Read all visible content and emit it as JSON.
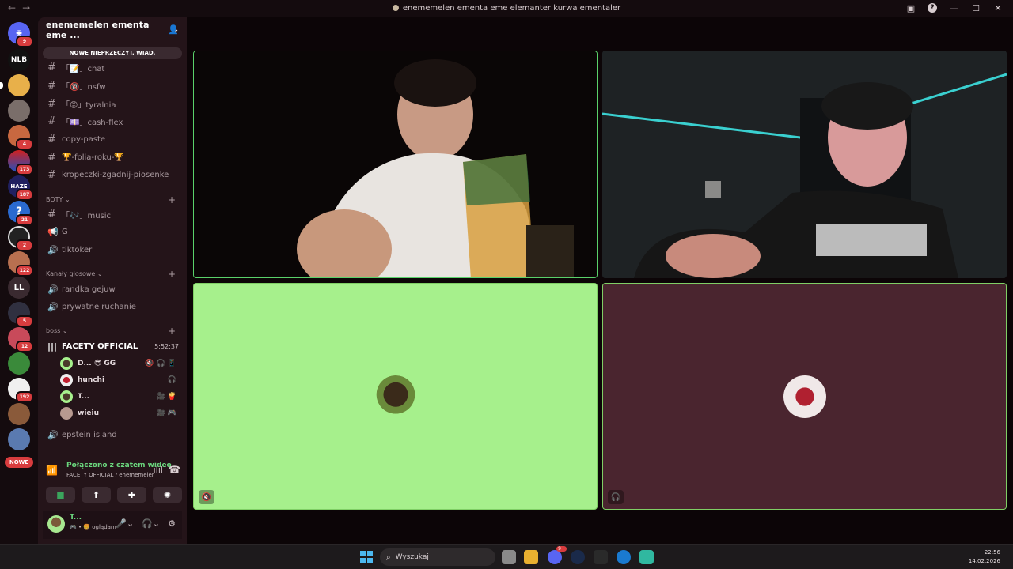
{
  "window": {
    "title": "enememelen ementa eme elemanter kurwa ementaler",
    "nav_back": "←",
    "nav_forward": "→",
    "help": "?",
    "minimize": "—",
    "maximize": "☐",
    "close": "✕"
  },
  "rail": {
    "home_badge": "9",
    "servers": [
      {
        "initials": "NLB",
        "badge": ""
      },
      {
        "initials": "",
        "badge": ""
      },
      {
        "initials": "",
        "badge": ""
      },
      {
        "initials": "",
        "badge": "4"
      },
      {
        "initials": "",
        "badge": "173"
      },
      {
        "initials": "HAZE",
        "badge": "187"
      },
      {
        "initials": "?",
        "badge": "21"
      },
      {
        "initials": "",
        "badge": "2"
      },
      {
        "initials": "",
        "badge": "122"
      },
      {
        "initials": "LL",
        "badge": ""
      },
      {
        "initials": "",
        "badge": "5"
      },
      {
        "initials": "",
        "badge": "12"
      },
      {
        "initials": "",
        "badge": ""
      },
      {
        "initials": "",
        "badge": "192"
      },
      {
        "initials": "",
        "badge": ""
      },
      {
        "initials": "",
        "badge": ""
      }
    ],
    "new_label": "NOWE"
  },
  "sidebar": {
    "guild_name": "enememelen ementa eme ...",
    "new_unread": "NOWE NIEPRZECZYT. WIAD.",
    "channels_top": [
      {
        "label": "「📝」chat"
      },
      {
        "label": "「🔞」nsfw"
      },
      {
        "label": "「😡」tyralnia"
      },
      {
        "label": "「💷」cash-flex"
      },
      {
        "label": "copy-paste"
      },
      {
        "label": "🏆-folia-roku-🏆"
      },
      {
        "label": "kropeczki-zgadnij-piosenke"
      }
    ],
    "cat_boty": "BOTY",
    "boty_channels": [
      {
        "label": "「🎶」music",
        "kind": "text"
      },
      {
        "label": "G",
        "kind": "stage"
      },
      {
        "label": "tiktoker",
        "kind": "voice"
      }
    ],
    "cat_voice": "Kanały głosowe",
    "voice_channels": [
      {
        "label": "randka gejuw"
      },
      {
        "label": "prywatne ruchanie"
      }
    ],
    "cat_boss": "boss",
    "active_channel": "FACETY OFFICIAL",
    "active_timer": "5:52:37",
    "voice_users": [
      {
        "name": "D... 😎 GG",
        "icons": "🔇🎧📱"
      },
      {
        "name": "hunchi",
        "icons": "🎧"
      },
      {
        "name": "T...",
        "icons": "🎥🍟"
      },
      {
        "name": "wieiu",
        "icons": "🎥🎮"
      }
    ],
    "last_channel": "epstein island"
  },
  "voice_panel": {
    "status": "Połączono z czatem wideo",
    "location": "FACETY OFFICIAL / enememelen e..."
  },
  "user_panel": {
    "name": "T...",
    "status": "🎮 • 🍔 oglądam"
  },
  "taskbar": {
    "search_placeholder": "Wyszukaj",
    "discord_badge": "9+",
    "time": "22:56",
    "date": "14.02.2026"
  }
}
